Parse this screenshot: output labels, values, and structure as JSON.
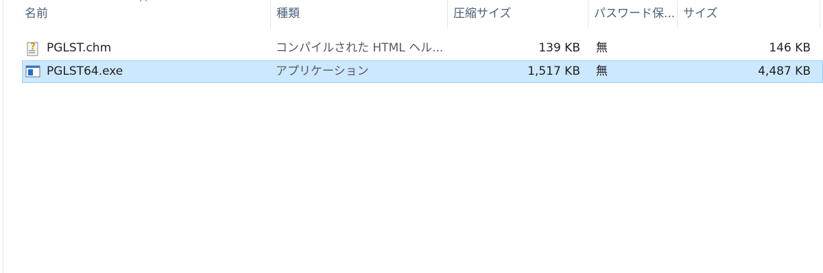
{
  "columns": {
    "name": "名前",
    "type": "種類",
    "compressed_size": "圧縮サイズ",
    "password": "パスワード保...",
    "size": "サイズ"
  },
  "sort": {
    "column": "name",
    "direction": "ascending",
    "icon": "chevron-up-icon"
  },
  "files": [
    {
      "name": "PGLST.chm",
      "icon": "help-file-icon",
      "type": "コンパイルされた HTML ヘル...",
      "compressed_size": "139 KB",
      "password": "無",
      "size": "146 KB",
      "selected": false
    },
    {
      "name": "PGLST64.exe",
      "icon": "application-icon",
      "type": "アプリケーション",
      "compressed_size": "1,517 KB",
      "password": "無",
      "size": "4,487 KB",
      "selected": true
    }
  ],
  "colors": {
    "header_text": "#4c607a",
    "selection_bg": "#cce8ff",
    "selection_border": "#99d1ff"
  }
}
